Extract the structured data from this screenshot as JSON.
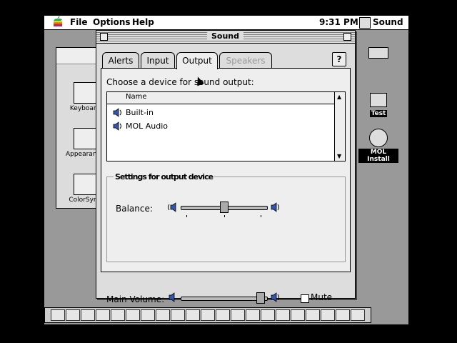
{
  "menubar": {
    "items": [
      "File",
      "Options",
      "Help"
    ],
    "clock": "9:31 PM",
    "app_name": "Sound"
  },
  "background_window": {
    "control_panels": [
      "Keyboard",
      "Appearance",
      "ColorSync"
    ]
  },
  "desktop_icons": [
    "",
    "Test",
    "MOL Install"
  ],
  "sound_window": {
    "title": "Sound",
    "tabs": [
      {
        "label": "Alerts",
        "state": "normal"
      },
      {
        "label": "Input",
        "state": "normal"
      },
      {
        "label": "Output",
        "state": "selected"
      },
      {
        "label": "Speakers",
        "state": "disabled"
      }
    ],
    "help_button": "?",
    "choose_label": "Choose a device for sound output:",
    "list_header": "Name",
    "devices": [
      "Built-in",
      "MOL Audio"
    ],
    "settings_label": "Settings for output device",
    "balance_label": "Balance:",
    "balance_value": 0.5,
    "main_volume_label": "Main Volume:",
    "main_volume_value": 0.96,
    "mute_label": "Mute",
    "mute_checked": false
  },
  "icons": {
    "apple": "apple-menu-icon",
    "speaker": "speaker-icon",
    "scroll_up": "scroll-up-arrow-icon",
    "scroll_down": "scroll-down-arrow-icon"
  },
  "colors": {
    "desktop": "#999999",
    "window": "#dddddd",
    "panel": "#eeeeee"
  }
}
